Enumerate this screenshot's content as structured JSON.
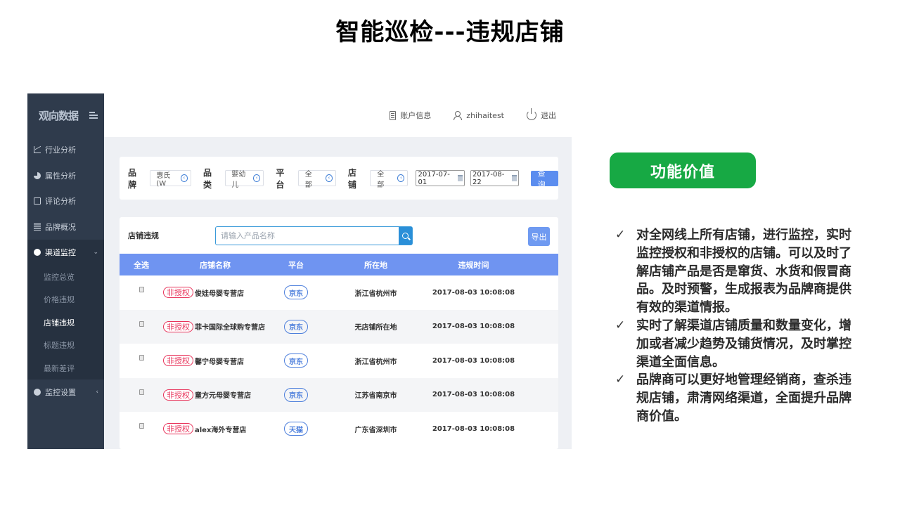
{
  "slide": {
    "title": "智能巡检---违规店铺",
    "value_label": "功能价值",
    "bullets": [
      "对全网线上所有店铺，进行监控，实时监控授权和非授权的店铺。可以及时了解店铺产品是否是窜货、水货和假冒商品。及时预警，生成报表为品牌商提供有效的渠道情报。",
      "实时了解渠道店铺质量和数量变化，增加或者减少趋势及铺货情况，及时掌控渠道全面信息。",
      "品牌商可以更好地管理经销商，查杀违规店铺，肃清网络渠道，全面提升品牌商价值。"
    ],
    "tick": "✓"
  },
  "app": {
    "logo": "观向数据",
    "nav": [
      {
        "label": "行业分析",
        "icon": "line-chart-icon"
      },
      {
        "label": "属性分析",
        "icon": "pie-chart-icon"
      },
      {
        "label": "评论分析",
        "icon": "edit-icon"
      },
      {
        "label": "品牌概况",
        "icon": "document-icon"
      },
      {
        "label": "渠道监控",
        "icon": "radar-icon",
        "caret": "⌄"
      },
      {
        "label": "监控设置",
        "icon": "gear-icon",
        "caret": "‹"
      }
    ],
    "sub_nav": [
      "监控总览",
      "价格违规",
      "店铺违规",
      "标题违规",
      "最新差评"
    ],
    "top": {
      "account": "账户信息",
      "user": "zhihaitest",
      "logout": "退出"
    },
    "filters": {
      "brand_label": "品牌",
      "brand_value": "惠氏(W",
      "category_label": "品类",
      "category_value": "婴幼儿",
      "platform_label": "平台",
      "platform_value": "全部",
      "shop_label": "店铺",
      "shop_value": "全部",
      "date_start": "2017-07-01",
      "date_end": "2017-08-22",
      "query_button": "查询",
      "chevron": "‹"
    },
    "table": {
      "title": "店铺违规",
      "search_placeholder": "请输入产品名称",
      "export_button": "导出",
      "columns": [
        "全选",
        "店铺名称",
        "平台",
        "所在地",
        "违规时间"
      ],
      "rows": [
        {
          "badge": "非授权",
          "shop": "俊娃母婴专营店",
          "platform": "京东",
          "location": "浙江省杭州市",
          "time": "2017-08-03 10:08:08"
        },
        {
          "badge": "非授权",
          "shop": "菲卡国际全球购专营店",
          "platform": "京东",
          "location": "无店铺所在地",
          "time": "2017-08-03 10:08:08"
        },
        {
          "badge": "非授权",
          "shop": "馨宁母婴专营店",
          "platform": "京东",
          "location": "浙江省杭州市",
          "time": "2017-08-03 10:08:08"
        },
        {
          "badge": "非授权",
          "shop": "童方元母婴专营店",
          "platform": "京东",
          "location": "江苏省南京市",
          "time": "2017-08-03 10:08:08"
        },
        {
          "badge": "非授权",
          "shop": "alex海外专营店",
          "platform": "天猫",
          "location": "广东省深圳市",
          "time": "2017-08-03 10:08:08"
        }
      ]
    }
  },
  "colors": {
    "sidebar": "#2f3b4c",
    "table_header": "#6f94f1",
    "value_pill": "#17a944",
    "badge_red": "#e8335a",
    "badge_blue": "#4d7fdc"
  }
}
